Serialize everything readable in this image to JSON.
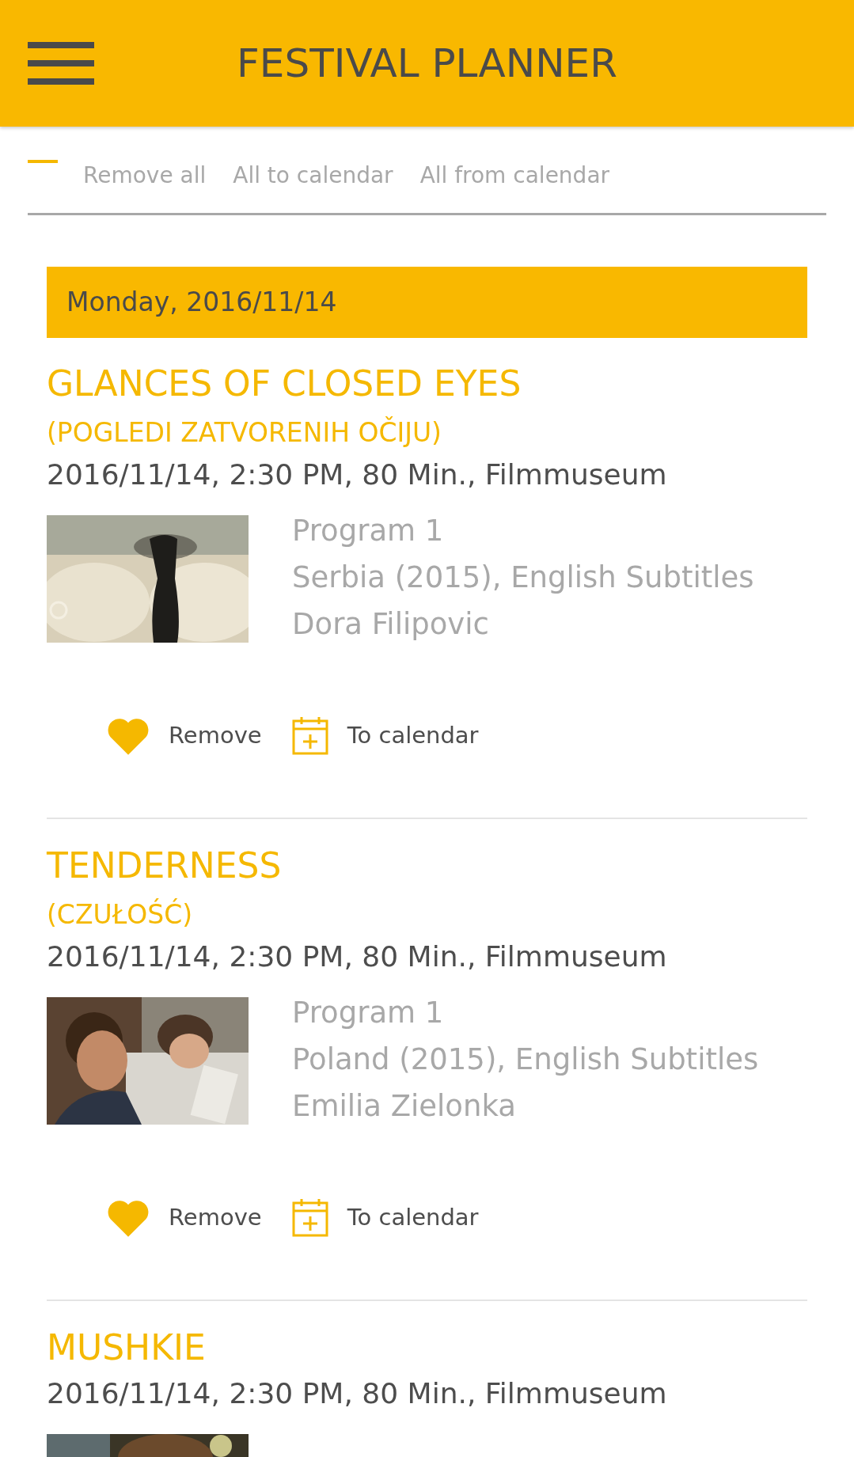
{
  "app_bar": {
    "title": "FESTIVAL PLANNER"
  },
  "toolbar": [
    "Remove all",
    "All to calendar",
    "All from calendar"
  ],
  "day": {
    "label": "Monday, 2016/11/14"
  },
  "films": [
    {
      "title": "GLANCES OF CLOSED EYES",
      "original_title": "(POGLEDI ZATVORENIH OČIJU)",
      "schedule": "2016/11/14, 2:30 PM, 80 Min., Filmmuseum",
      "picture": {
        "kind": "picture"
      },
      "details": [
        "Program 1",
        "Serbia (2015), English Subtitles",
        "Dora Filipovic"
      ],
      "actions": [
        {
          "kind": "favorite",
          "label": "Remove"
        },
        {
          "kind": "calendar",
          "label": "To calendar"
        }
      ]
    },
    {
      "title": "TENDERNESS",
      "original_title": "(CZUŁOŚĆ)",
      "schedule": "2016/11/14, 2:30 PM, 80 Min., Filmmuseum",
      "picture": {
        "kind": "picture"
      },
      "details": [
        "Program 1",
        "Poland (2015), English Subtitles",
        "Emilia Zielonka"
      ],
      "actions": [
        {
          "kind": "favorite",
          "label": "Remove"
        },
        {
          "kind": "calendar",
          "label": "To calendar"
        }
      ]
    },
    {
      "title": "MUSHKIE",
      "schedule": "2016/11/14, 2:30 PM, 80 Min., Filmmuseum",
      "picture": {
        "kind": "picture"
      }
    }
  ]
}
